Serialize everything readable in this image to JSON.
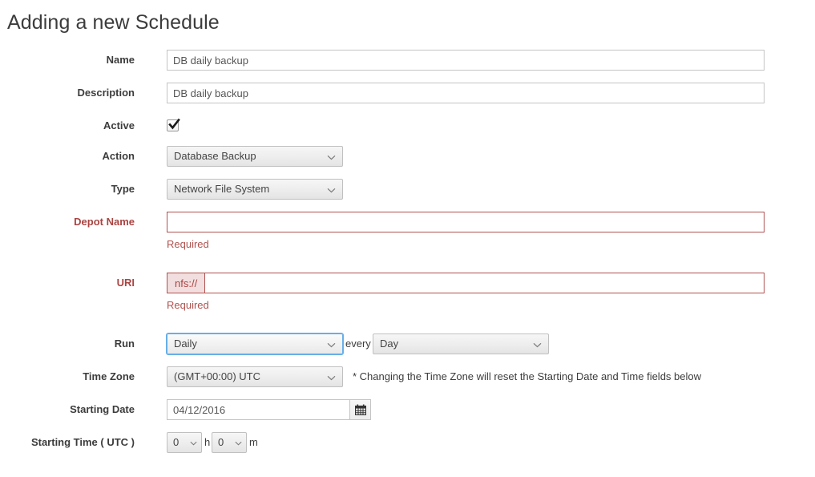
{
  "page": {
    "title": "Adding a new Schedule"
  },
  "form": {
    "name": {
      "label": "Name",
      "value": "DB daily backup",
      "placeholder": ""
    },
    "description": {
      "label": "Description",
      "value": "DB daily backup",
      "placeholder": ""
    },
    "active": {
      "label": "Active",
      "checked": true,
      "icon": "checkmark-icon"
    },
    "action": {
      "label": "Action",
      "value": "Database Backup",
      "icon": "chevron-down-icon"
    },
    "type": {
      "label": "Type",
      "value": "Network File System",
      "icon": "chevron-down-icon"
    },
    "depot_name": {
      "label": "Depot Name",
      "value": "",
      "placeholder": "",
      "error": "Required"
    },
    "uri": {
      "label": "URI",
      "prefix": "nfs://",
      "value": "",
      "placeholder": "",
      "error": "Required"
    },
    "run": {
      "label": "Run",
      "value": "Daily",
      "icon": "chevron-down-icon",
      "every_label": "every",
      "every_value": "Day",
      "every_icon": "chevron-down-icon"
    },
    "time_zone": {
      "label": "Time Zone",
      "value": "(GMT+00:00) UTC",
      "icon": "chevron-down-icon",
      "note": "* Changing the Time Zone will reset the Starting Date and Time fields below"
    },
    "starting_date": {
      "label": "Starting Date",
      "value": "04/12/2016",
      "placeholder": "",
      "icon": "calendar-icon"
    },
    "starting_time": {
      "label": "Starting Time ( UTC )",
      "hours_value": "0",
      "hours_unit": "h",
      "minutes_value": "0",
      "minutes_unit": "m",
      "icon": "chevron-down-icon"
    }
  },
  "colors": {
    "error": "#a94442",
    "error_border": "#b0534f",
    "error_bg": "#f2dede",
    "focus": "#66afe9",
    "text": "#3c3c3c"
  }
}
